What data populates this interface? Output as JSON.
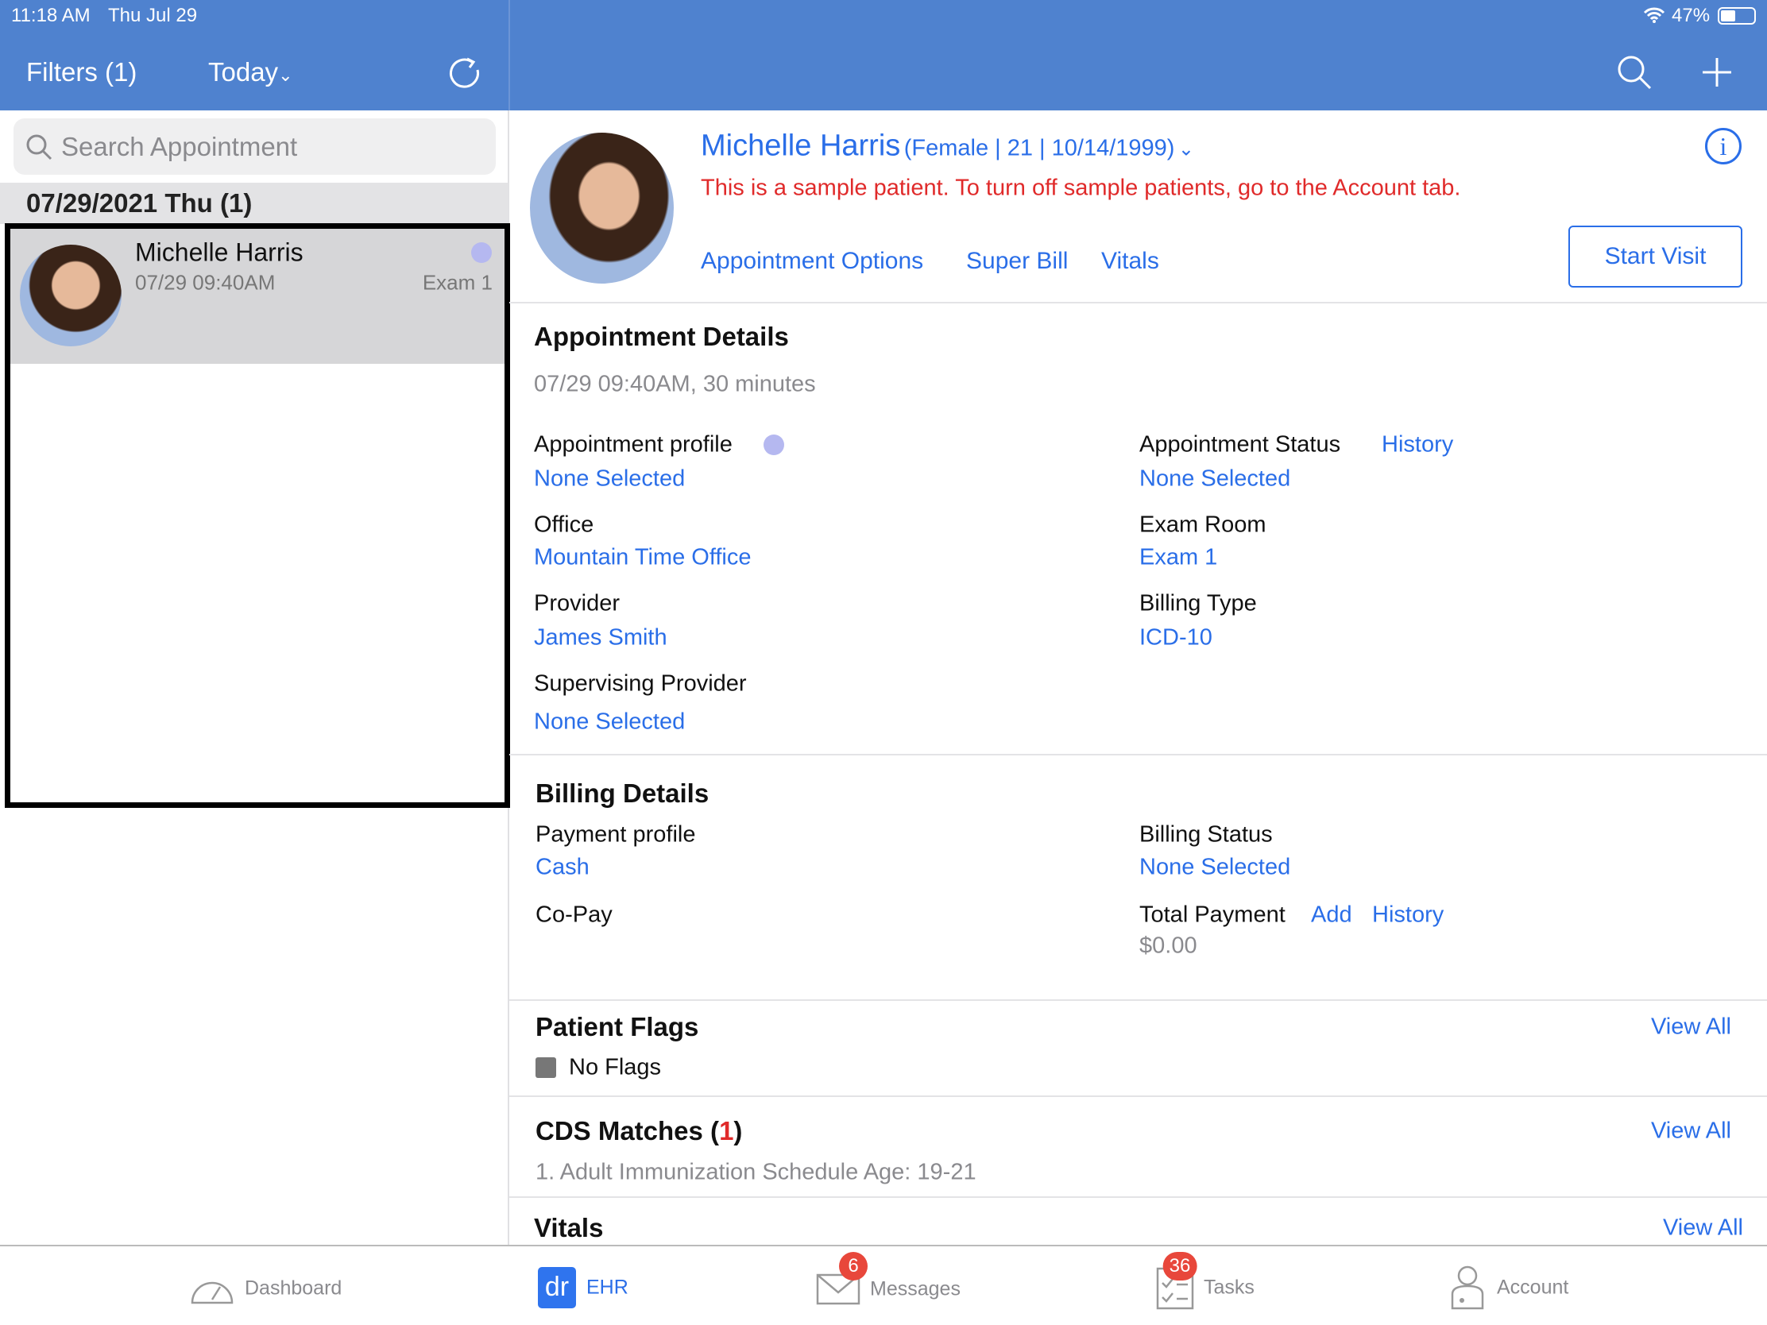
{
  "status_bar": {
    "time": "11:18 AM",
    "date": "Thu Jul 29",
    "battery": "47%"
  },
  "left_header": {
    "filters": "Filters (1)",
    "today": "Today"
  },
  "search": {
    "placeholder": "Search Appointment"
  },
  "list": {
    "date_header": "07/29/2021 Thu (1)",
    "items": [
      {
        "name": "Michelle Harris",
        "time": "07/29 09:40AM",
        "room": "Exam 1",
        "profile_color": "#b5b8f0"
      }
    ]
  },
  "patient": {
    "name": "Michelle Harris",
    "meta": "(Female | 21 | 10/14/1999)",
    "notice": "This is a sample patient. To turn off sample patients, go to the Account tab.",
    "links": [
      "Appointment Options",
      "Super Bill",
      "Vitals"
    ],
    "start_visit": "Start Visit"
  },
  "appointment": {
    "title": "Appointment Details",
    "when": "07/29 09:40AM, 30 minutes",
    "profile_label": "Appointment profile",
    "profile_value": "None Selected",
    "status_label": "Appointment Status",
    "status_history": "History",
    "status_value": "None Selected",
    "office_label": "Office",
    "office_value": "Mountain Time Office",
    "room_label": "Exam Room",
    "room_value": "Exam 1",
    "provider_label": "Provider",
    "provider_value": "James Smith",
    "billing_type_label": "Billing Type",
    "billing_type_value": "ICD-10",
    "supervising_label": "Supervising Provider",
    "supervising_value": "None Selected"
  },
  "billing": {
    "title": "Billing Details",
    "payment_profile_label": "Payment profile",
    "payment_profile_value": "Cash",
    "billing_status_label": "Billing Status",
    "billing_status_value": "None Selected",
    "copay_label": "Co-Pay",
    "total_label": "Total Payment",
    "add": "Add",
    "history": "History",
    "total_value": "$0.00"
  },
  "flags": {
    "title": "Patient Flags",
    "view_all": "View All",
    "none": "No Flags"
  },
  "cds": {
    "title_pre": "CDS Matches (",
    "count": "1",
    "title_post": ")",
    "view_all": "View All",
    "item": "1. Adult Immunization Schedule Age: 19-21"
  },
  "vitals": {
    "title": "Vitals",
    "view_all": "View All"
  },
  "tabbar": {
    "dashboard": "Dashboard",
    "ehr": "EHR",
    "ehr_logo": "dr",
    "messages": "Messages",
    "messages_badge": "6",
    "tasks": "Tasks",
    "tasks_badge": "36",
    "account": "Account"
  },
  "colors": {
    "header": "#4f82cf",
    "accent": "#2a6ee8",
    "alert": "#e02a2a",
    "badge": "#e8473b"
  }
}
